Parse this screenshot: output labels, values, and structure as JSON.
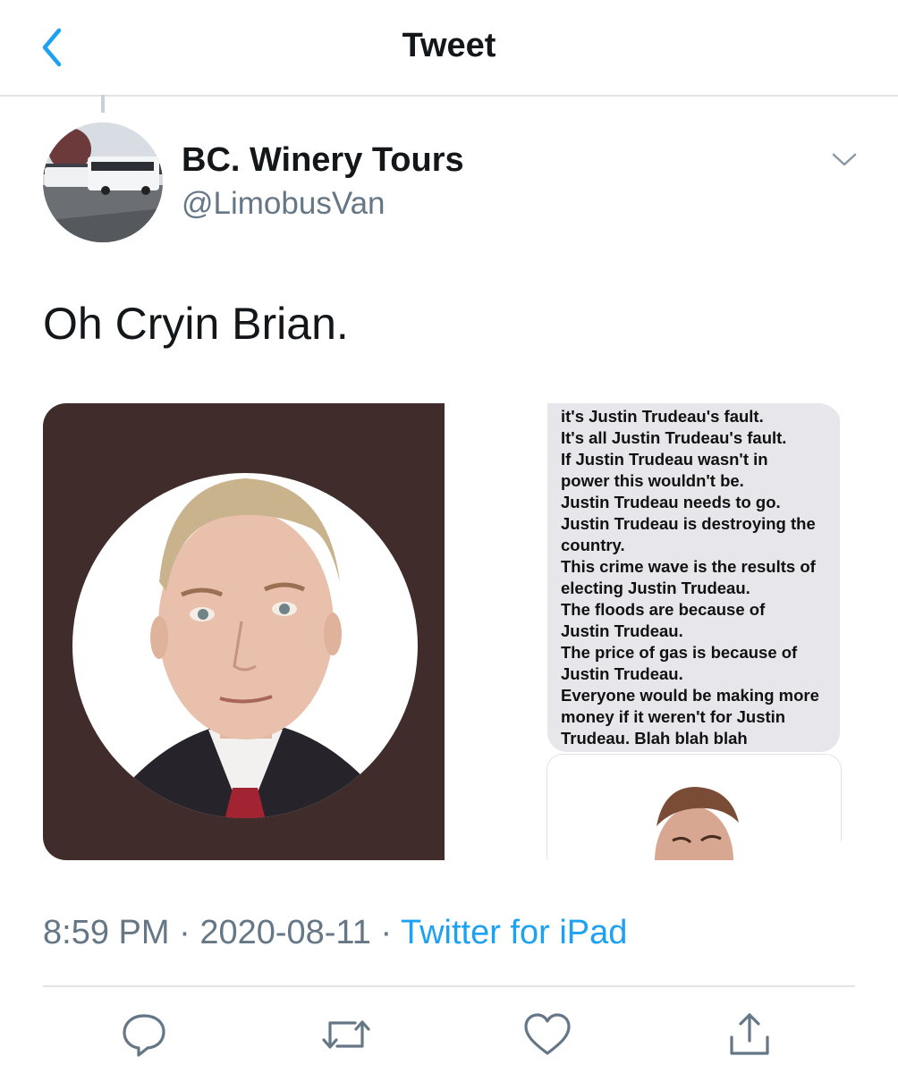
{
  "header": {
    "title": "Tweet",
    "back_icon": "chevron-left-icon"
  },
  "tweet": {
    "author_name": "BC. Winery Tours",
    "author_handle": "@LimobusVan",
    "text": "Oh Cryin Brian.",
    "screenshot_text": "it's Justin Trudeau's fault.\nIt's all Justin Trudeau's fault.\nIf Justin Trudeau wasn't in\npower this wouldn't be.\nJustin Trudeau needs to go.\nJustin Trudeau is destroying the\ncountry.\nThis crime wave is the results of\nelecting Justin Trudeau.\nThe floods are because of\nJustin Trudeau.\nThe price of gas is because of\nJustin Trudeau.\nEveryone would be making more\nmoney if it weren't for Justin\nTrudeau. Blah blah blah",
    "time": "8:59 PM",
    "separator": "·",
    "date": "2020-08-11",
    "source": "Twitter for iPad"
  },
  "actions": [
    "reply-icon",
    "retweet-icon",
    "like-icon",
    "share-icon"
  ],
  "colors": {
    "accent": "#1da1f2",
    "secondary_text": "#657786",
    "divider": "#e1e3e5"
  }
}
